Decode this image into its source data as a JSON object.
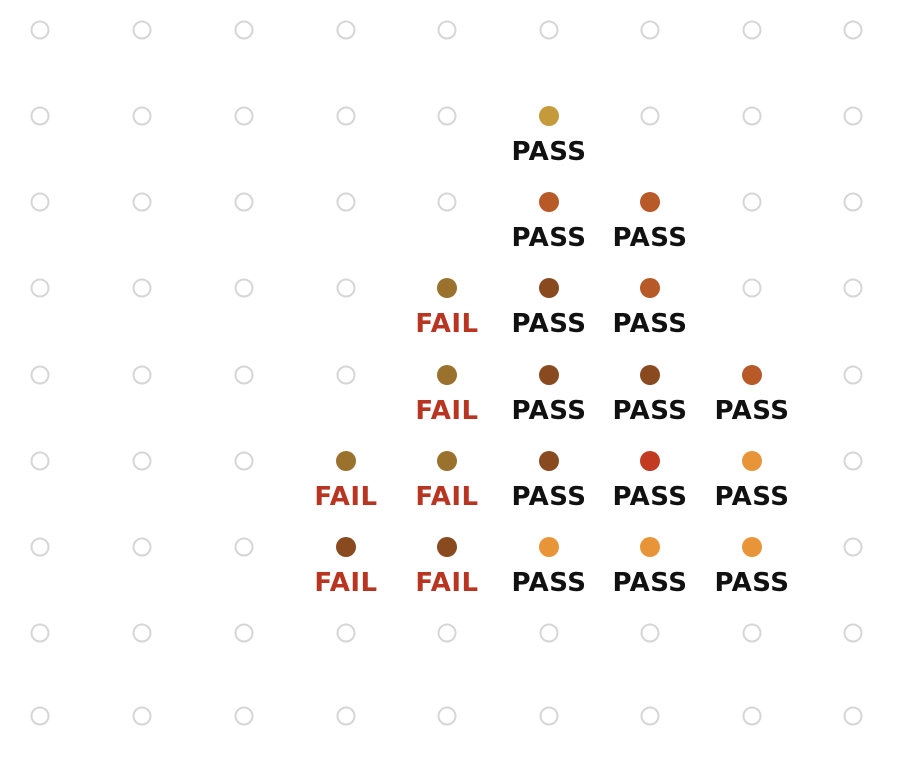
{
  "colors": {
    "grid_outline": "#d6d6d6",
    "pass_text": "#111111",
    "fail_text": "#b83522"
  },
  "cells": [
    {
      "row": 1,
      "col": 5,
      "dot": "#c49a3a",
      "label": "PASS"
    },
    {
      "row": 2,
      "col": 5,
      "dot": "#b85a28",
      "label": "PASS"
    },
    {
      "row": 2,
      "col": 6,
      "dot": "#b85a28",
      "label": "PASS"
    },
    {
      "row": 3,
      "col": 4,
      "dot": "#9a722d",
      "label": "FAIL"
    },
    {
      "row": 3,
      "col": 5,
      "dot": "#8a4a20",
      "label": "PASS"
    },
    {
      "row": 3,
      "col": 6,
      "dot": "#b85a28",
      "label": "PASS"
    },
    {
      "row": 4,
      "col": 4,
      "dot": "#9a722d",
      "label": "FAIL"
    },
    {
      "row": 4,
      "col": 5,
      "dot": "#8a4a20",
      "label": "PASS"
    },
    {
      "row": 4,
      "col": 6,
      "dot": "#8a4a20",
      "label": "PASS"
    },
    {
      "row": 4,
      "col": 7,
      "dot": "#b85a28",
      "label": "PASS"
    },
    {
      "row": 5,
      "col": 3,
      "dot": "#9a722d",
      "label": "FAIL"
    },
    {
      "row": 5,
      "col": 4,
      "dot": "#9a722d",
      "label": "FAIL"
    },
    {
      "row": 5,
      "col": 5,
      "dot": "#8a4a20",
      "label": "PASS"
    },
    {
      "row": 5,
      "col": 6,
      "dot": "#c23a22",
      "label": "PASS"
    },
    {
      "row": 5,
      "col": 7,
      "dot": "#e8953a",
      "label": "PASS"
    },
    {
      "row": 6,
      "col": 3,
      "dot": "#8a4a20",
      "label": "FAIL"
    },
    {
      "row": 6,
      "col": 4,
      "dot": "#8a4a20",
      "label": "FAIL"
    },
    {
      "row": 6,
      "col": 5,
      "dot": "#e8953a",
      "label": "PASS"
    },
    {
      "row": 6,
      "col": 6,
      "dot": "#e8953a",
      "label": "PASS"
    },
    {
      "row": 6,
      "col": 7,
      "dot": "#e8953a",
      "label": "PASS"
    }
  ]
}
